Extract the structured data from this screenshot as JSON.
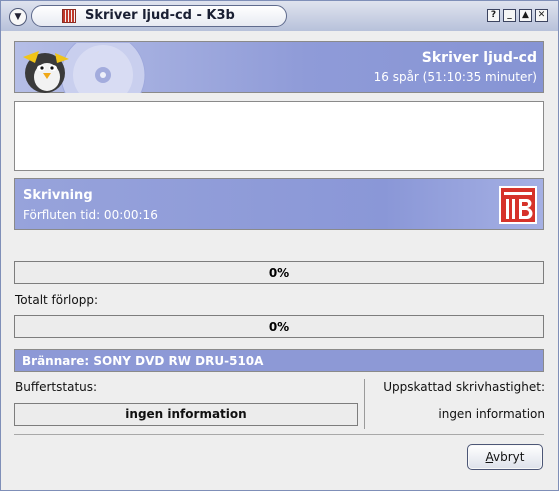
{
  "window": {
    "title": "Skriver ljud-cd - K3b",
    "buttons": [
      "?",
      "_",
      "▲",
      "✕"
    ]
  },
  "header": {
    "title": "Skriver ljud-cd",
    "subtitle": "16 spår (51:10:35 minuter)"
  },
  "status": {
    "title": "Skrivning",
    "elapsed": "Förfluten tid: 00:00:16"
  },
  "progress": {
    "current_percent_label": "0%",
    "current_fraction": 0.0,
    "total_label": "Totalt förlopp:",
    "total_percent_label": "0%",
    "total_fraction": 0.0
  },
  "burner": {
    "label": "Brännare: SONY DVD RW DRU-510A"
  },
  "buffer": {
    "label": "Buffertstatus:",
    "value": "ingen information"
  },
  "speed": {
    "label": "Uppskattad skrivhastighet:",
    "value": "ingen information"
  },
  "actions": {
    "cancel_accel": "A",
    "cancel_rest": "vbryt"
  },
  "colors": {
    "accent": "#8d99d6",
    "panel_text": "#ffffff"
  },
  "icons": {
    "header_logo": "k3b-penguin-disc-icon",
    "status_badge": "k3b-logo-badge-icon",
    "app_icon": "k3b-app-icon"
  }
}
